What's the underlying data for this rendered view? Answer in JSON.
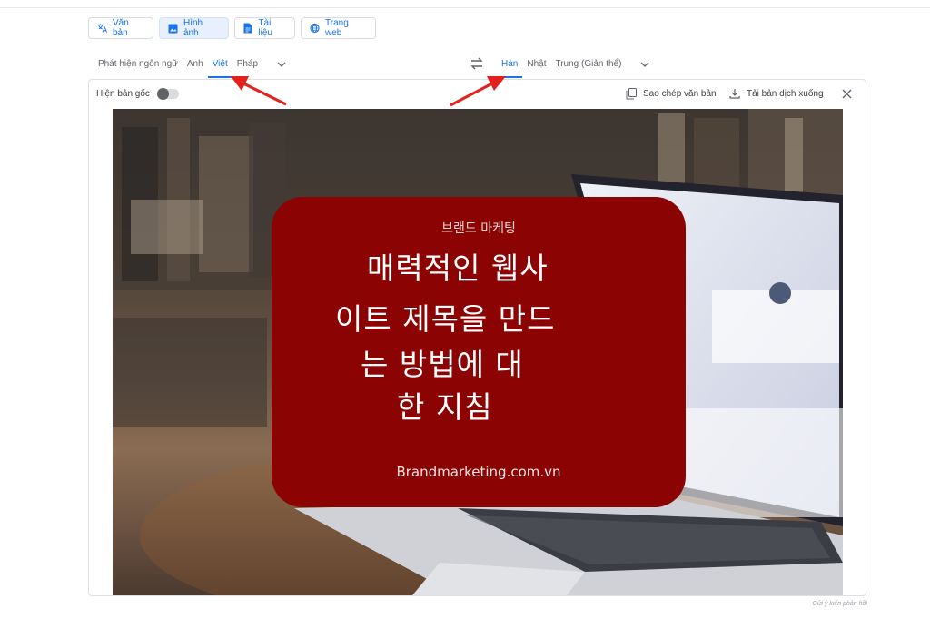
{
  "mode_tabs": [
    {
      "label": "Văn bản",
      "icon": "translate-icon"
    },
    {
      "label": "Hình ảnh",
      "icon": "image-icon"
    },
    {
      "label": "Tài liệu",
      "icon": "document-icon"
    },
    {
      "label": "Trang web",
      "icon": "globe-icon"
    }
  ],
  "source_langs": [
    "Phát hiện ngôn ngữ",
    "Anh",
    "Việt",
    "Pháp"
  ],
  "target_langs": [
    "Hàn",
    "Nhật",
    "Trung (Giản thể)"
  ],
  "toolbar": {
    "show_original": "Hiện bản gốc",
    "copy": "Sao chép văn bản",
    "download": "Tải bản dịch xuống"
  },
  "image": {
    "subtitle": "브랜드 마케팅",
    "lines": [
      "매력적인 웹사",
      "이트 제목을 만드",
      "는 방법에 대",
      "한 지침"
    ],
    "domain": "Brandmarketing.com.vn"
  },
  "feedback": "Gửi ý kiến phản hồi",
  "colors": {
    "accent": "#1a73e8",
    "overlay": "#8b0303",
    "arrow": "#e3201b"
  }
}
